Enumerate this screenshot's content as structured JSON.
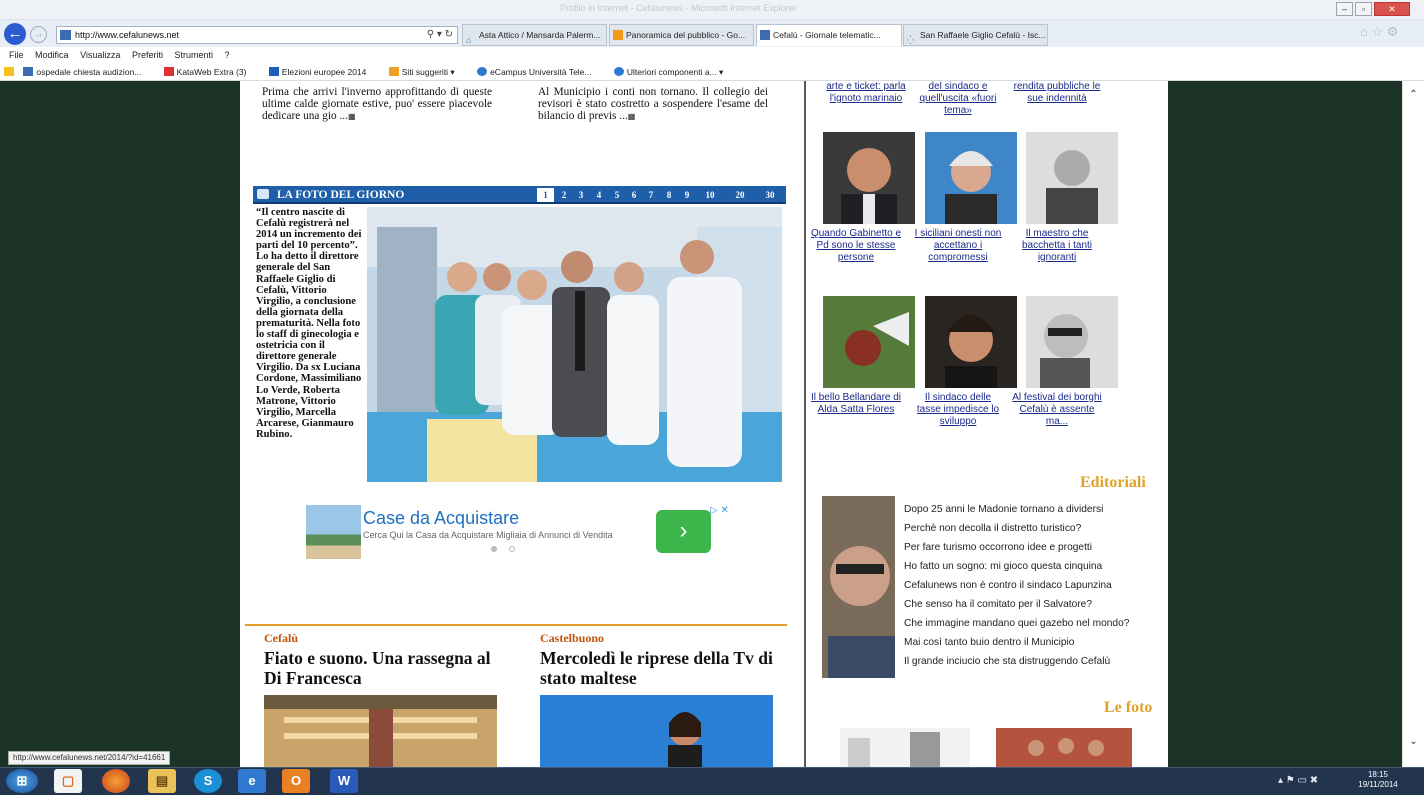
{
  "browser": {
    "window_title": "Profilo in Internet - Cefalunews - Microsoft Internet Explorer",
    "address": "http://www.cefalunews.net",
    "tabs": [
      {
        "label": "Asta Attico / Mansarda Palerm..."
      },
      {
        "label": "Panoramica del pubblico - Go..."
      },
      {
        "label": "Cefalù - Giornale telematic..."
      },
      {
        "label": "San Raffaele Giglio Cefalù - Isc..."
      }
    ],
    "menu": [
      "File",
      "Modifica",
      "Visualizza",
      "Preferiti",
      "Strumenti",
      "?"
    ],
    "favorites": [
      "ospedale chiesta audizion...",
      "KataWeb Extra (3)",
      "Elezioni europee 2014",
      "Siti suggeriti ▾",
      "eCampus Università Tele...",
      "Ulteriori componenti a... ▾"
    ],
    "status_url": "http://www.cefalunews.net/2014/?id=41661"
  },
  "intro": {
    "left": "Prima che arrivi l'inverno approfittando di queste ultime calde giornate estive, puo' essere piacevole dedicare una gio ...",
    "right": "Al Municipio i conti non tornano. Il collegio dei revisori è stato costretto a sospendere l'esame del bilancio di previs ..."
  },
  "foto_del_giorno": {
    "title": "LA FOTO DEL GIORNO",
    "pages": [
      "1",
      "2",
      "3",
      "4",
      "5",
      "6",
      "7",
      "8",
      "9",
      "10",
      "20",
      "30"
    ],
    "caption": "“Il centro nascite di Cefalù registrerà nel 2014 un incremento dei parti del 10 percento”. Lo ha detto il direttore generale del San Raffaele Giglio di Cefalù, Vittorio Virgilio, a conclusione della giornata della prematurità. Nella foto lo staff di ginecologia e ostetricia con il direttore generale Virgilio. Da sx Luciana Cordone, Massimiliano Lo Verde, Roberta Matrone, Vittorio Virgilio, Marcella Arcarese, Gianmauro Rubino."
  },
  "ad": {
    "title": "Case da Acquistare",
    "subtitle": "Cerca Qui la Casa da Acquistare Migliaia di Annunci di Vendita",
    "button": "›"
  },
  "articles": [
    {
      "category": "Cefalù",
      "headline": "Fiato e suono. Una rassegna al Di Francesca"
    },
    {
      "category": "Castelbuono",
      "headline": "Mercoledì le riprese della Tv di stato maltese"
    }
  ],
  "top_links": [
    {
      "label": "arte e ticket: parla l'ignoto marinaio"
    },
    {
      "label": "del sindaco e quell'uscita «fuori tema»"
    },
    {
      "label": "rendita pubbliche le sue indennità"
    }
  ],
  "thumbs": [
    {
      "label": "Quando Gabinetto e Pd sono le stesse persone"
    },
    {
      "label": "I siciliani onesti non accettano i compromessi"
    },
    {
      "label": "Il maestro che bacchetta i tanti ignoranti"
    },
    {
      "label": "Il bello Bellandare di Alda Satta Flores"
    },
    {
      "label": "Il sindaco delle tasse impedisce lo sviluppo"
    },
    {
      "label": "Al festival dei borghi Cefalù è assente ma..."
    }
  ],
  "editoriali": {
    "title": "Editoriali",
    "items": [
      "Dopo 25 anni le Madonie tornano a dividersi",
      "Perchè non decolla il distretto turistico?",
      "Per fare turismo occorrono idee e progetti",
      "Ho fatto un sogno: mi gioco questa cinquina",
      "Cefalunews non è contro il sindaco Lapunzina",
      "Che senso ha il comitato per il Salvatore?",
      "Che immagine mandano quei gazebo nel mondo?",
      "Mai così tanto buio dentro il Municipio",
      "Il grande inciucio che sta distruggendo Cefalù"
    ]
  },
  "le_foto": {
    "title": "Le foto"
  },
  "taskbar": {
    "time": "18:15",
    "date": "19/11/2014"
  }
}
